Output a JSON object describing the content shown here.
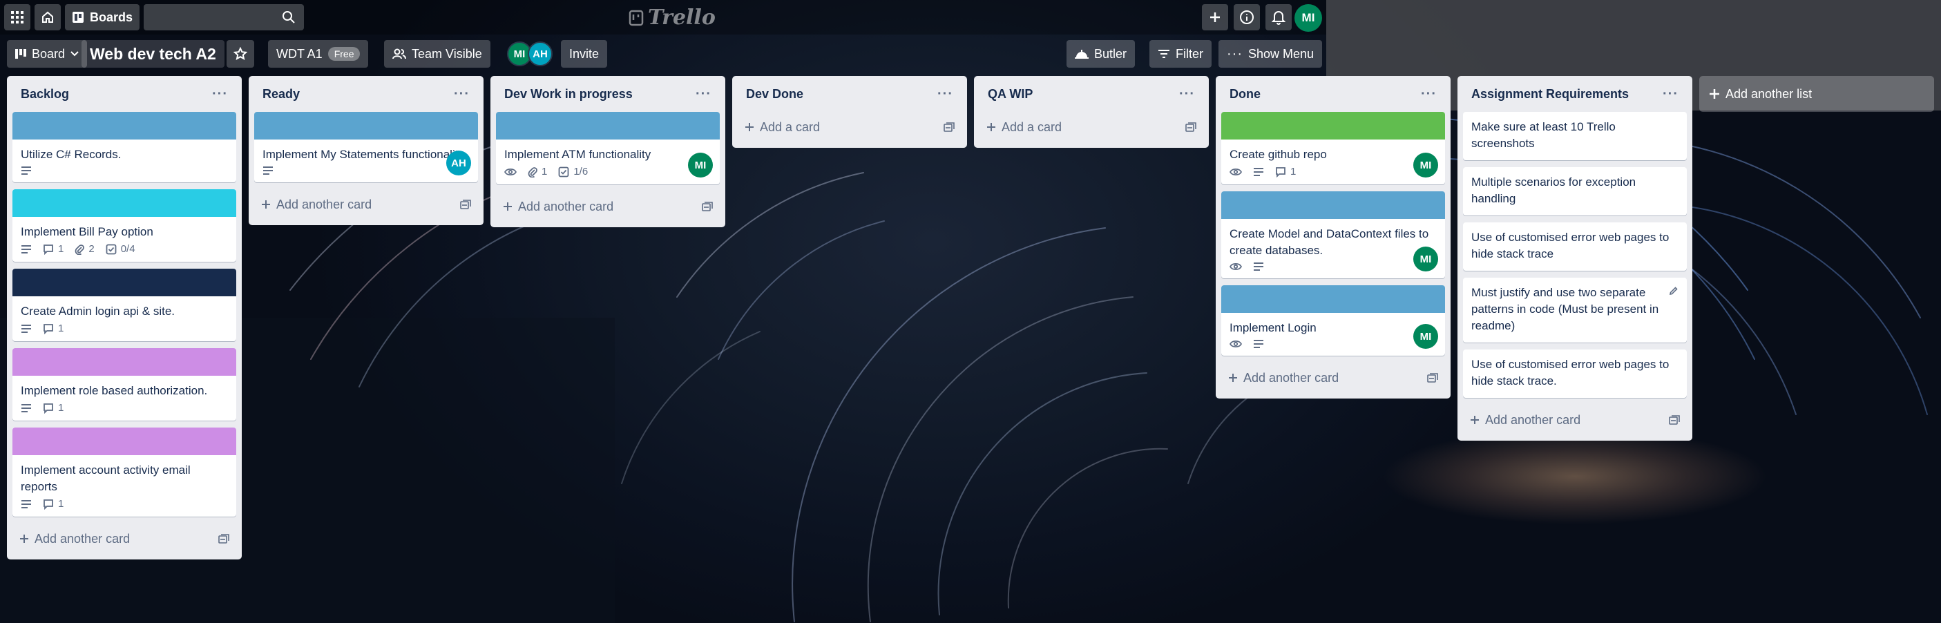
{
  "header": {
    "boards_label": "Boards",
    "logo_text": "Trello",
    "user_initials": "MI"
  },
  "board_bar": {
    "view_label": "Board",
    "board_title": "Web dev tech A2",
    "workspace_label": "WDT A1",
    "workspace_tag": "Free",
    "visibility_label": "Team Visible",
    "members": [
      "MI",
      "AH"
    ],
    "invite_label": "Invite",
    "butler_label": "Butler",
    "filter_label": "Filter",
    "menu_label": "Show Menu"
  },
  "lists": [
    {
      "title": "Backlog",
      "add_label": "Add another card",
      "cards": [
        {
          "label_color": "#5ba4cf",
          "title": "Utilize C# Records.",
          "desc": true
        },
        {
          "label_color": "#29cce5",
          "title": "Implement Bill Pay option",
          "desc": true,
          "comments": "1",
          "attachments": "2",
          "checklist": "0/4"
        },
        {
          "label_color": "#172b4d",
          "title": "Create Admin login api & site.",
          "desc": true,
          "comments": "1"
        },
        {
          "label_color": "#cd8de5",
          "title": "Implement role based authorization.",
          "desc": true,
          "comments": "1"
        },
        {
          "label_color": "#cd8de5",
          "title": "Implement account activity email reports",
          "desc": true,
          "comments": "1"
        }
      ]
    },
    {
      "title": "Ready",
      "add_label": "Add another card",
      "cards": [
        {
          "label_color": "#5ba4cf",
          "title": "Implement My Statements functionality.",
          "desc": true,
          "member": "AH"
        }
      ]
    },
    {
      "title": "Dev Work in progress",
      "add_label": "Add another card",
      "cards": [
        {
          "label_color": "#5ba4cf",
          "title": "Implement ATM functionality",
          "watch": true,
          "attachments": "1",
          "checklist": "1/6",
          "member": "MI"
        }
      ]
    },
    {
      "title": "Dev Done",
      "add_label": "Add a card",
      "cards": []
    },
    {
      "title": "QA WIP",
      "add_label": "Add a card",
      "cards": []
    },
    {
      "title": "Done",
      "add_label": "Add another card",
      "cards": [
        {
          "label_color": "#61bd4f",
          "title": "Create github repo",
          "watch": true,
          "desc": true,
          "comments": "1",
          "member": "MI"
        },
        {
          "label_color": "#5ba4cf",
          "title": "Create Model and DataContext files to create databases.",
          "watch": true,
          "desc": true,
          "member": "MI"
        },
        {
          "label_color": "#5ba4cf",
          "title": "Implement Login",
          "watch": true,
          "desc": true,
          "member": "MI"
        }
      ]
    },
    {
      "title": "Assignment Requirements",
      "add_label": "Add another card",
      "cards": [
        {
          "title": "Make sure at least 10 Trello screenshots"
        },
        {
          "title": "Multiple scenarios for exception handling"
        },
        {
          "title": "Use of customised error web pages to hide stack trace"
        },
        {
          "title": "Must justify and use two separate patterns in code (Must be present in readme)",
          "edit": true
        },
        {
          "title": "Use of customised error web pages to hide stack trace."
        }
      ]
    }
  ],
  "add_list_label": "Add another list",
  "colors": {
    "mi_avatar": "#00875a",
    "ah_avatar": "#00a3bf"
  }
}
